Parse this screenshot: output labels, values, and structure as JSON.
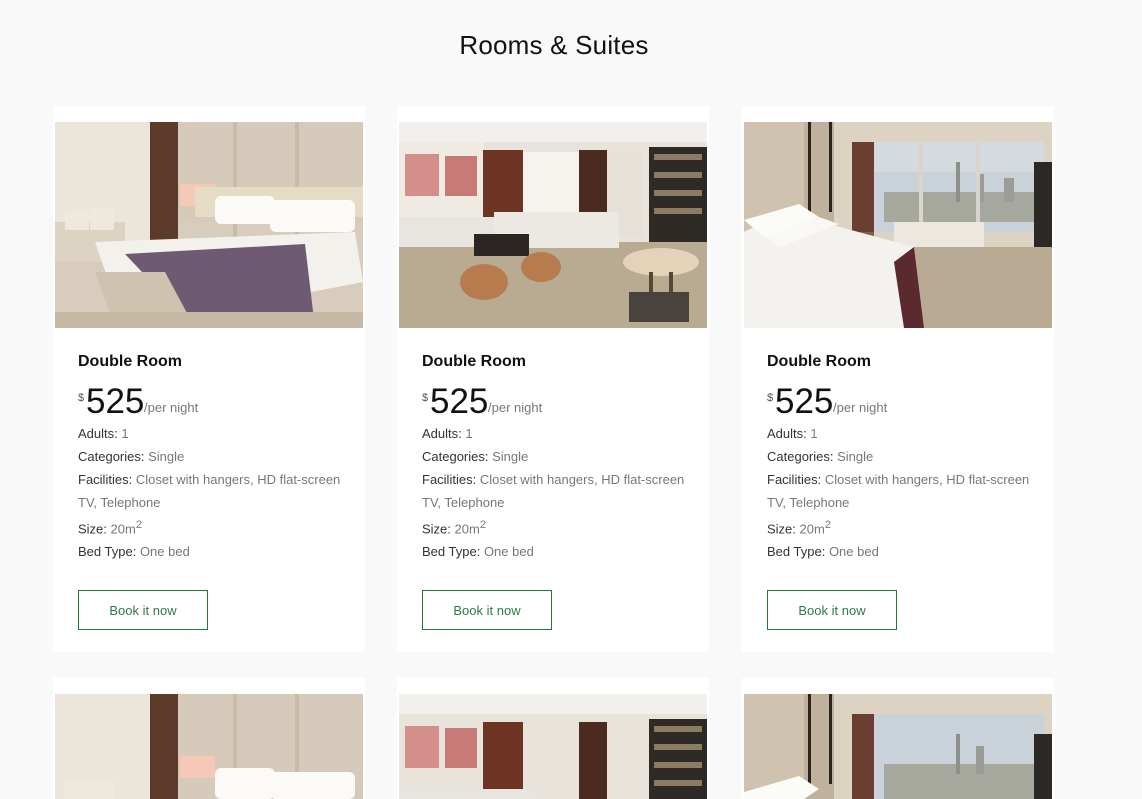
{
  "page": {
    "title": "Rooms & Suites"
  },
  "rooms": [
    {
      "name": "Double Room",
      "currency": "$",
      "price": "525",
      "per": "/per night",
      "adults_label": "Adults:",
      "adults": "1",
      "categories_label": "Categories:",
      "categories": "Single",
      "facilities_label": "Facilities:",
      "facilities": "Closet with hangers, HD flat-screen TV, Telephone",
      "size_label": "Size:",
      "size": "20m",
      "size_sup": "2",
      "bed_label": "Bed Type:",
      "bed": "One bed",
      "button": "Book it now"
    },
    {
      "name": "Double Room",
      "currency": "$",
      "price": "525",
      "per": "/per night",
      "adults_label": "Adults:",
      "adults": "1",
      "categories_label": "Categories:",
      "categories": "Single",
      "facilities_label": "Facilities:",
      "facilities": "Closet with hangers, HD flat-screen TV, Telephone",
      "size_label": "Size:",
      "size": "20m",
      "size_sup": "2",
      "bed_label": "Bed Type:",
      "bed": "One bed",
      "button": "Book it now"
    },
    {
      "name": "Double Room",
      "currency": "$",
      "price": "525",
      "per": "/per night",
      "adults_label": "Adults:",
      "adults": "1",
      "categories_label": "Categories:",
      "categories": "Single",
      "facilities_label": "Facilities:",
      "facilities": "Closet with hangers, HD flat-screen TV, Telephone",
      "size_label": "Size:",
      "size": "20m",
      "size_sup": "2",
      "bed_label": "Bed Type:",
      "bed": "One bed",
      "button": "Book it now"
    }
  ],
  "colors": {
    "accent": "#1e7a3a",
    "background": "#f9f9f9",
    "card": "#ffffff"
  }
}
